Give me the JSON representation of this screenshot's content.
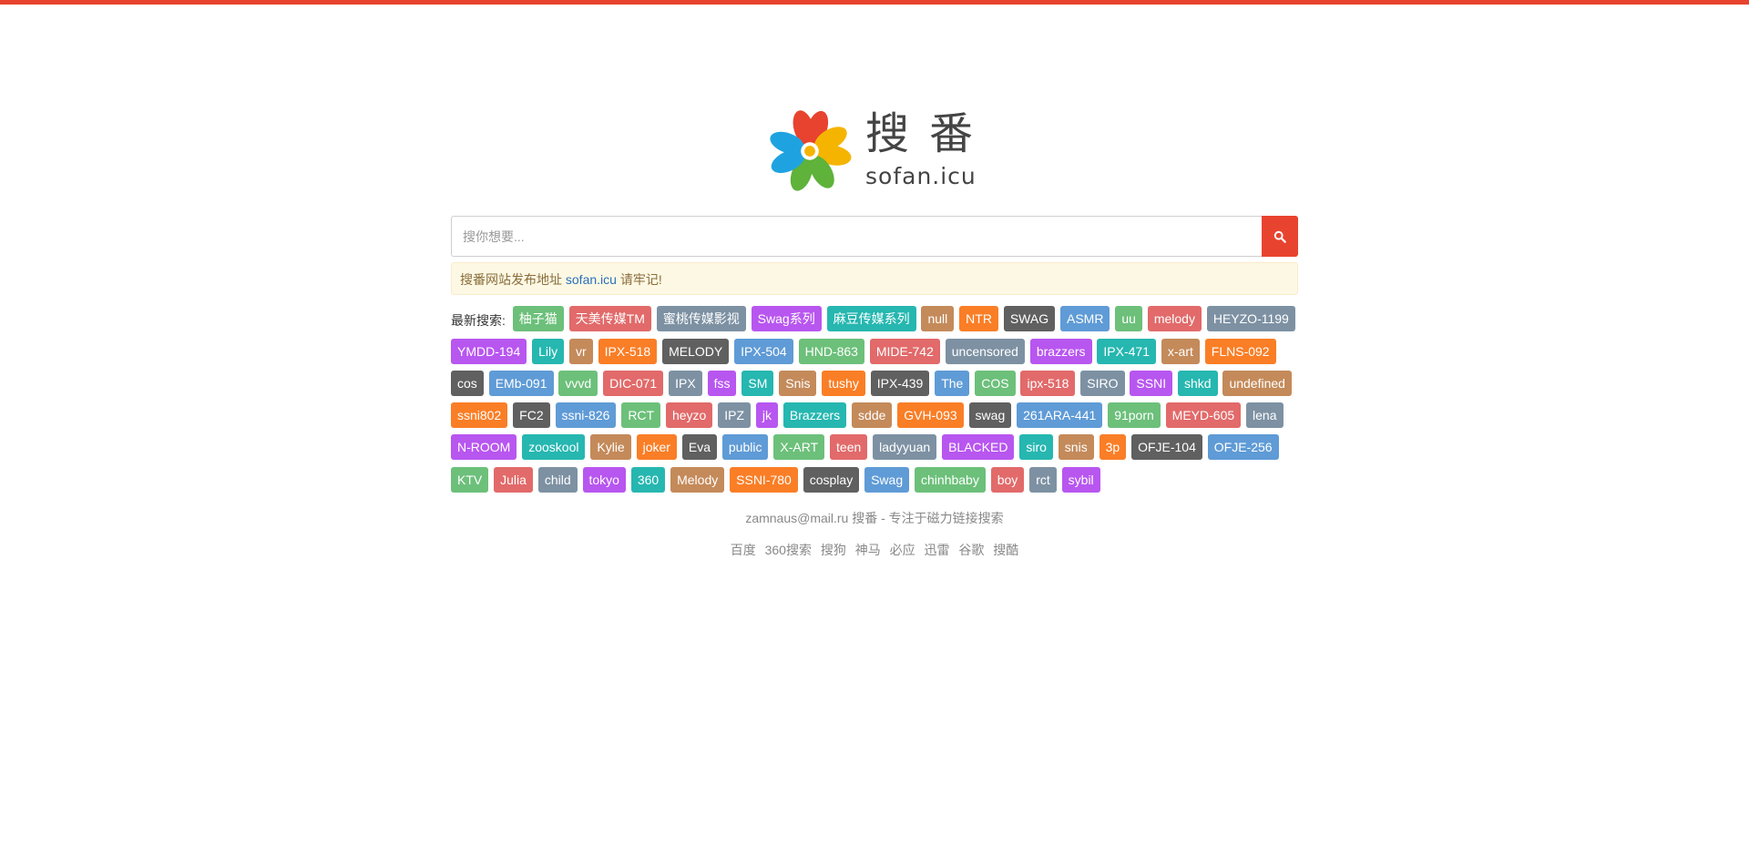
{
  "colors": {
    "accent": "#e8432e",
    "tag_palette": [
      "#6cc07a",
      "#e26a6a",
      "#7d91a3",
      "#b856f0",
      "#26b7b0",
      "#c48a5a",
      "#fa7e26",
      "#606060",
      "#5f9bd6",
      "#6cc07a"
    ]
  },
  "logo": {
    "cn": "搜番",
    "en": "sofan.icu",
    "icon": "flower-logo-icon"
  },
  "search": {
    "placeholder": "搜你想要...",
    "value": "",
    "button_icon": "search-icon"
  },
  "notice": {
    "prefix": "搜番网站发布地址 ",
    "link": "sofan.icu",
    "suffix": " 请牢记!"
  },
  "tags": {
    "label": "最新搜索:",
    "items": [
      {
        "t": "柚子猫",
        "c": "#6cc07a"
      },
      {
        "t": "天美传媒TM",
        "c": "#e26a6a"
      },
      {
        "t": "蜜桃传媒影视",
        "c": "#7d91a3"
      },
      {
        "t": "Swag系列",
        "c": "#b856f0"
      },
      {
        "t": "麻豆传媒系列",
        "c": "#26b7b0"
      },
      {
        "t": "null",
        "c": "#c48a5a"
      },
      {
        "t": "NTR",
        "c": "#fa7e26"
      },
      {
        "t": "SWAG",
        "c": "#606060"
      },
      {
        "t": "ASMR",
        "c": "#5f9bd6"
      },
      {
        "t": "uu",
        "c": "#6cc07a"
      },
      {
        "t": "melody",
        "c": "#e26a6a"
      },
      {
        "t": "HEYZO-1199",
        "c": "#7d91a3"
      },
      {
        "t": "YMDD-194",
        "c": "#b856f0"
      },
      {
        "t": "Lily",
        "c": "#26b7b0"
      },
      {
        "t": "vr",
        "c": "#c48a5a"
      },
      {
        "t": "IPX-518",
        "c": "#fa7e26"
      },
      {
        "t": "MELODY",
        "c": "#606060"
      },
      {
        "t": "IPX-504",
        "c": "#5f9bd6"
      },
      {
        "t": "HND-863",
        "c": "#6cc07a"
      },
      {
        "t": "MIDE-742",
        "c": "#e26a6a"
      },
      {
        "t": "uncensored",
        "c": "#7d91a3"
      },
      {
        "t": "brazzers",
        "c": "#b856f0"
      },
      {
        "t": "IPX-471",
        "c": "#26b7b0"
      },
      {
        "t": "x-art",
        "c": "#c48a5a"
      },
      {
        "t": "FLNS-092",
        "c": "#fa7e26"
      },
      {
        "t": "cos",
        "c": "#606060"
      },
      {
        "t": "EMb-091",
        "c": "#5f9bd6"
      },
      {
        "t": "vvvd",
        "c": "#6cc07a"
      },
      {
        "t": "DIC-071",
        "c": "#e26a6a"
      },
      {
        "t": "IPX",
        "c": "#7d91a3"
      },
      {
        "t": "fss",
        "c": "#b856f0"
      },
      {
        "t": "SM",
        "c": "#26b7b0"
      },
      {
        "t": "Snis",
        "c": "#c48a5a"
      },
      {
        "t": "tushy",
        "c": "#fa7e26"
      },
      {
        "t": "IPX-439",
        "c": "#606060"
      },
      {
        "t": "The",
        "c": "#5f9bd6"
      },
      {
        "t": "COS",
        "c": "#6cc07a"
      },
      {
        "t": "ipx-518",
        "c": "#e26a6a"
      },
      {
        "t": "SIRO",
        "c": "#7d91a3"
      },
      {
        "t": "SSNI",
        "c": "#b856f0"
      },
      {
        "t": "shkd",
        "c": "#26b7b0"
      },
      {
        "t": "undefined",
        "c": "#c48a5a"
      },
      {
        "t": "ssni802",
        "c": "#fa7e26"
      },
      {
        "t": "FC2",
        "c": "#606060"
      },
      {
        "t": "ssni-826",
        "c": "#5f9bd6"
      },
      {
        "t": "RCT",
        "c": "#6cc07a"
      },
      {
        "t": "heyzo",
        "c": "#e26a6a"
      },
      {
        "t": "IPZ",
        "c": "#7d91a3"
      },
      {
        "t": "jk",
        "c": "#b856f0"
      },
      {
        "t": "Brazzers",
        "c": "#26b7b0"
      },
      {
        "t": "sdde",
        "c": "#c48a5a"
      },
      {
        "t": "GVH-093",
        "c": "#fa7e26"
      },
      {
        "t": "swag",
        "c": "#606060"
      },
      {
        "t": "261ARA-441",
        "c": "#5f9bd6"
      },
      {
        "t": "91porn",
        "c": "#6cc07a"
      },
      {
        "t": "MEYD-605",
        "c": "#e26a6a"
      },
      {
        "t": "lena",
        "c": "#7d91a3"
      },
      {
        "t": "N-ROOM",
        "c": "#b856f0"
      },
      {
        "t": "zooskool",
        "c": "#26b7b0"
      },
      {
        "t": "Kylie",
        "c": "#c48a5a"
      },
      {
        "t": "joker",
        "c": "#fa7e26"
      },
      {
        "t": "Eva",
        "c": "#606060"
      },
      {
        "t": "public",
        "c": "#5f9bd6"
      },
      {
        "t": "X-ART",
        "c": "#6cc07a"
      },
      {
        "t": "teen",
        "c": "#e26a6a"
      },
      {
        "t": "ladyyuan",
        "c": "#7d91a3"
      },
      {
        "t": "BLACKED",
        "c": "#b856f0"
      },
      {
        "t": "siro",
        "c": "#26b7b0"
      },
      {
        "t": "snis",
        "c": "#c48a5a"
      },
      {
        "t": "3p",
        "c": "#fa7e26"
      },
      {
        "t": "OFJE-104",
        "c": "#606060"
      },
      {
        "t": "OFJE-256",
        "c": "#5f9bd6"
      },
      {
        "t": "KTV",
        "c": "#6cc07a"
      },
      {
        "t": "Julia",
        "c": "#e26a6a"
      },
      {
        "t": "child",
        "c": "#7d91a3"
      },
      {
        "t": "tokyo",
        "c": "#b856f0"
      },
      {
        "t": "360",
        "c": "#26b7b0"
      },
      {
        "t": "Melody",
        "c": "#c48a5a"
      },
      {
        "t": "SSNI-780",
        "c": "#fa7e26"
      },
      {
        "t": "cosplay",
        "c": "#606060"
      },
      {
        "t": "Swag",
        "c": "#5f9bd6"
      },
      {
        "t": "chinhbaby",
        "c": "#6cc07a"
      },
      {
        "t": "boy",
        "c": "#e26a6a"
      },
      {
        "t": "rct",
        "c": "#7d91a3"
      },
      {
        "t": "sybil",
        "c": "#b856f0"
      }
    ]
  },
  "footer": {
    "line": "zamnaus@mail.ru 搜番 - 专注于磁力链接搜索",
    "links": [
      "百度",
      "360搜索",
      "搜狗",
      "神马",
      "必应",
      "迅雷",
      "谷歌",
      "搜酷"
    ]
  }
}
